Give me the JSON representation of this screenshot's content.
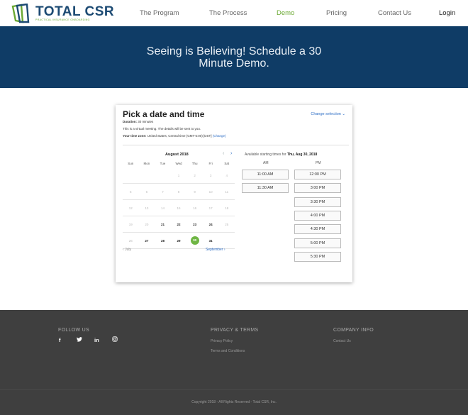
{
  "header": {
    "logo_word_total": "TOTAL",
    "logo_word_csr": "CSR",
    "logo_tagline": "PRACTICAL INSURANCE ONBOARDING",
    "nav": [
      "The Program",
      "The Process",
      "Demo",
      "Pricing",
      "Contact Us"
    ],
    "login": "Login",
    "active_nav": "Demo"
  },
  "hero": {
    "line1": "Seeing is Believing! Schedule a 30",
    "line2": "Minute Demo."
  },
  "scheduler": {
    "title": "Pick a date and time",
    "change_selection": "Change selection",
    "duration_label": "Duration:",
    "duration_value": "30 minutes",
    "virtual_note": "This is a virtual meeting. The details will be sent to you.",
    "timezone_label": "Your time zone:",
    "timezone_value": "United States;  Central time  (GMT-5:00) [DST]",
    "timezone_change": "(Change)",
    "month": "August 2018",
    "weekdays": [
      "Sun",
      "Mon",
      "Tue",
      "Wed",
      "Thu",
      "Fri",
      "Sat"
    ],
    "weeks": [
      [
        "",
        "",
        "",
        "1",
        "2",
        "3",
        "4"
      ],
      [
        "5",
        "6",
        "7",
        "8",
        "9",
        "10",
        "11"
      ],
      [
        "12",
        "13",
        "14",
        "15",
        "16",
        "17",
        "18"
      ],
      [
        "19",
        "20",
        "21",
        "22",
        "23",
        "24",
        "25"
      ],
      [
        "26",
        "27",
        "28",
        "29",
        "30",
        "31",
        ""
      ]
    ],
    "available_days": [
      "21",
      "22",
      "23",
      "24",
      "27",
      "28",
      "29",
      "31"
    ],
    "selected_day": "30",
    "prev_month": "July",
    "next_month": "September",
    "available_prefix": "Available starting times for",
    "available_date": "Thu, Aug 30, 2018",
    "am_label": "AM",
    "pm_label": "PM",
    "am_slots": [
      "11:00 AM",
      "11:30 AM"
    ],
    "pm_slots": [
      "12:00 PM",
      "3:00 PM",
      "3:30 PM",
      "4:00 PM",
      "4:30 PM",
      "5:00 PM",
      "5:30 PM"
    ]
  },
  "footer": {
    "follow_us": "FOLLOW US",
    "social_icons": [
      "facebook-icon",
      "twitter-icon",
      "linkedin-icon",
      "instagram-icon"
    ],
    "privacy_heading": "PRIVACY & TERMS",
    "privacy_policy": "Privacy Policy",
    "terms": "Terms and Conditions",
    "company_heading": "COMPANY INFO",
    "contact_us": "Contact Us",
    "copyright": "Copyright 2018 - All Rights Reserved - Total CSR, Inc."
  },
  "colors": {
    "brand_navy": "#0f3c66",
    "brand_green": "#6aa832",
    "selected_day": "#6fb644",
    "link_blue": "#2b6cc4",
    "footer_bg": "#3f3f3f"
  }
}
